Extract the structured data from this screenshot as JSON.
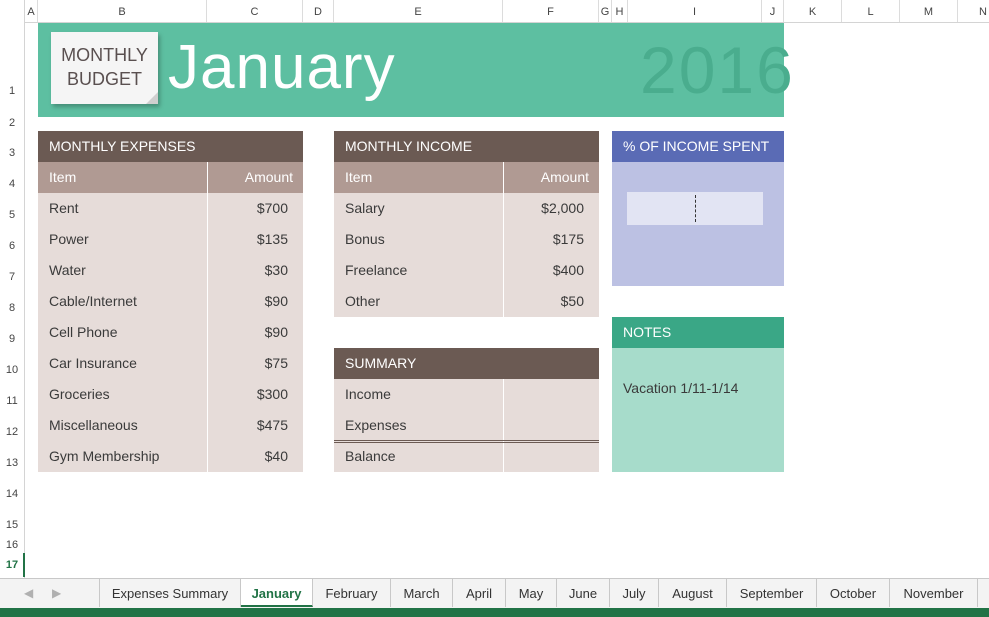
{
  "columns": [
    "A",
    "B",
    "C",
    "D",
    "E",
    "F",
    "G",
    "H",
    "I",
    "J",
    "K",
    "L",
    "M",
    "N"
  ],
  "rows": [
    "1",
    "2",
    "3",
    "4",
    "5",
    "6",
    "7",
    "8",
    "9",
    "10",
    "11",
    "12",
    "13",
    "14",
    "15",
    "16",
    "17"
  ],
  "active_row": "17",
  "banner": {
    "note_line1": "MONTHLY",
    "note_line2": "BUDGET",
    "title": "January",
    "year": "2016"
  },
  "expenses": {
    "title": "MONTHLY EXPENSES",
    "col_item": "Item",
    "col_amount": "Amount",
    "rows": [
      {
        "item": "Rent",
        "amount": "$700"
      },
      {
        "item": "Power",
        "amount": "$135"
      },
      {
        "item": "Water",
        "amount": "$30"
      },
      {
        "item": "Cable/Internet",
        "amount": "$90"
      },
      {
        "item": "Cell Phone",
        "amount": "$90"
      },
      {
        "item": "Car Insurance",
        "amount": "$75"
      },
      {
        "item": "Groceries",
        "amount": "$300"
      },
      {
        "item": "Miscellaneous",
        "amount": "$475"
      },
      {
        "item": "Gym Membership",
        "amount": "$40"
      }
    ]
  },
  "income": {
    "title": "MONTHLY INCOME",
    "col_item": "Item",
    "col_amount": "Amount",
    "rows": [
      {
        "item": "Salary",
        "amount": "$2,000"
      },
      {
        "item": "Bonus",
        "amount": "$175"
      },
      {
        "item": "Freelance",
        "amount": "$400"
      },
      {
        "item": "Other",
        "amount": "$50"
      }
    ]
  },
  "summary": {
    "title": "SUMMARY",
    "rows": [
      {
        "label": "Income",
        "value": ""
      },
      {
        "label": "Expenses",
        "value": ""
      },
      {
        "label": "Balance",
        "value": ""
      }
    ]
  },
  "percent": {
    "title": "% OF INCOME SPENT",
    "value": ""
  },
  "notes": {
    "title": "NOTES",
    "text": "Vacation 1/11-1/14"
  },
  "tabs": [
    "Expenses Summary",
    "January",
    "February",
    "March",
    "April",
    "May",
    "June",
    "July",
    "August",
    "September",
    "October",
    "November"
  ],
  "active_tab": "January",
  "colors": {
    "banner": "#5dbfa1",
    "panel_dark": "#6b5a53",
    "panel_sub": "#b09a93",
    "panel_body": "#e6dcd9",
    "percent_head": "#5a6bb5",
    "percent_body": "#bcc1e3",
    "notes_head": "#3aa786",
    "notes_body": "#a7dccb",
    "excel_green": "#217346"
  }
}
